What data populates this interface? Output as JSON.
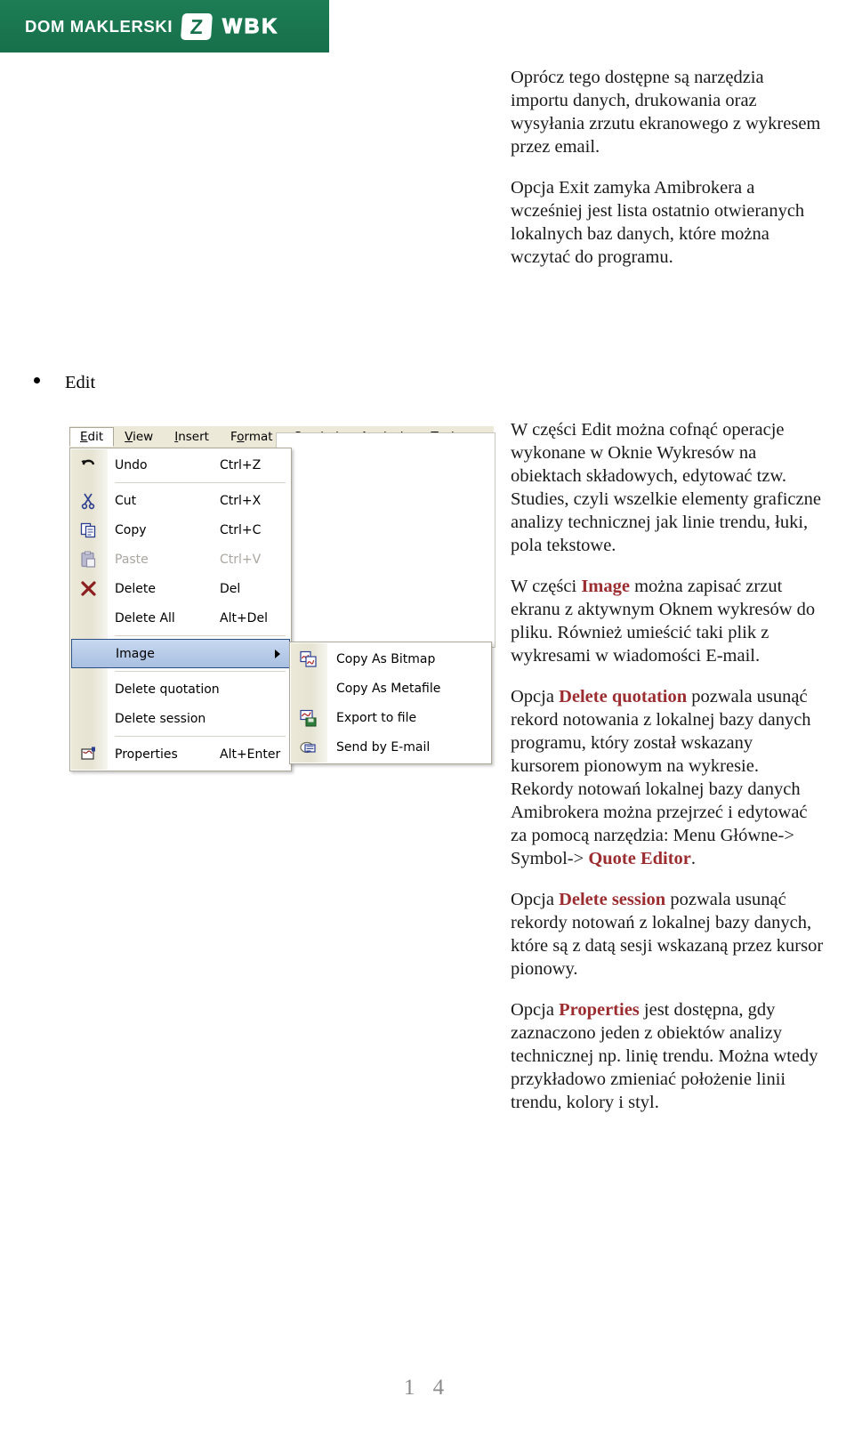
{
  "brand": {
    "name": "DOM MAKLERSKI",
    "mark": "Z",
    "sub": "WBK",
    "color": "#17704b"
  },
  "bullet": {
    "label": "Edit"
  },
  "intro": {
    "p1": "Oprócz tego dostępne są narzędzia importu danych, drukowania oraz wysyłania zrzutu ekranowego z wykresem przez email.",
    "p2": "Opcja Exit zamyka Amibrokera a wcześniej jest lista ostatnio otwieranych lokalnych baz danych, które można wczytać do programu."
  },
  "edit_desc": {
    "p1_a": "W części Edit można cofnąć operacje wykonane w Oknie Wykresów na obiektach składowych,  edytować tzw. Studies, czyli wszelkie elementy graficzne analizy technicznej jak linie trendu, łuki, pola tekstowe.",
    "p2_pre": "W części ",
    "p2_kw": "Image",
    "p2_post": "  można zapisać zrzut ekranu z aktywnym Oknem wykresów do pliku. Również umieścić taki plik z wykresami w wiadomości E-mail.",
    "p3_pre": "Opcja ",
    "p3_kw": "Delete quotation",
    "p3_mid": " pozwala usunąć rekord notowania z lokalnej bazy danych programu, który został wskazany kursorem pionowym na wykresie. Rekordy notowań lokalnej bazy danych Amibrokera można przejrzeć i edytować za pomocą narzędzia: Menu Główne-> Symbol-> ",
    "p3_kw2": "Quote Editor",
    "p3_post": ".",
    "p4_pre": "Opcja ",
    "p4_kw": "Delete session",
    "p4_post": " pozwala usunąć rekordy notowań z lokalnej bazy danych, które są z datą sesji wskazaną przez kursor pionowy.",
    "p5_pre": "Opcja ",
    "p5_kw": "Properties",
    "p5_post": " jest dostępna, gdy zaznaczono jeden z obiektów analizy technicznej np. linię trendu. Można wtedy przykładowo zmieniać położenie linii trendu, kolory i styl.",
    "keyword_color": "#9b2d30"
  },
  "menu_screenshot": {
    "menubar": [
      {
        "label": "Edit",
        "mnemonic": "E",
        "active": true
      },
      {
        "label": "View",
        "mnemonic": "V",
        "active": false
      },
      {
        "label": "Insert",
        "mnemonic": "I",
        "active": false
      },
      {
        "label": "Format",
        "mnemonic": "o",
        "active": false
      },
      {
        "label": "Symbol",
        "mnemonic": "S",
        "active": false
      },
      {
        "label": "Analysis",
        "mnemonic": "A",
        "active": false
      },
      {
        "label": "Tools",
        "mnemonic": "T",
        "active": false
      }
    ],
    "edit_menu": [
      {
        "label": "Undo",
        "accel": "Ctrl+Z",
        "icon": "undo-icon",
        "disabled": false,
        "selected": false,
        "separator_after": true,
        "submenu": false
      },
      {
        "label": "Cut",
        "accel": "Ctrl+X",
        "icon": "scissors-icon",
        "disabled": false,
        "selected": false,
        "separator_after": false,
        "submenu": false
      },
      {
        "label": "Copy",
        "accel": "Ctrl+C",
        "icon": "copy-icon",
        "disabled": false,
        "selected": false,
        "separator_after": false,
        "submenu": false
      },
      {
        "label": "Paste",
        "accel": "Ctrl+V",
        "icon": "paste-icon",
        "disabled": true,
        "selected": false,
        "separator_after": false,
        "submenu": false
      },
      {
        "label": "Delete",
        "accel": "Del",
        "icon": "delete-x-icon",
        "disabled": false,
        "selected": false,
        "separator_after": false,
        "submenu": false
      },
      {
        "label": "Delete All",
        "accel": "Alt+Del",
        "icon": "",
        "disabled": false,
        "selected": false,
        "separator_after": true,
        "submenu": false
      },
      {
        "label": "Image",
        "accel": "",
        "icon": "",
        "disabled": false,
        "selected": true,
        "separator_after": true,
        "submenu": true
      },
      {
        "label": "Delete quotation",
        "accel": "",
        "icon": "",
        "disabled": false,
        "selected": false,
        "separator_after": false,
        "submenu": false
      },
      {
        "label": "Delete session",
        "accel": "",
        "icon": "",
        "disabled": false,
        "selected": false,
        "separator_after": true,
        "submenu": false
      },
      {
        "label": "Properties",
        "accel": "Alt+Enter",
        "icon": "properties-icon",
        "disabled": false,
        "selected": false,
        "separator_after": false,
        "submenu": false
      }
    ],
    "image_submenu": [
      {
        "label": "Copy As Bitmap",
        "icon": "copy-bitmap-icon"
      },
      {
        "label": "Copy As Metafile",
        "icon": ""
      },
      {
        "label": "Export to file",
        "icon": "export-file-icon"
      },
      {
        "label": "Send by E-mail",
        "icon": "mail-icon"
      }
    ]
  },
  "footer": {
    "page_number": "1 4"
  }
}
